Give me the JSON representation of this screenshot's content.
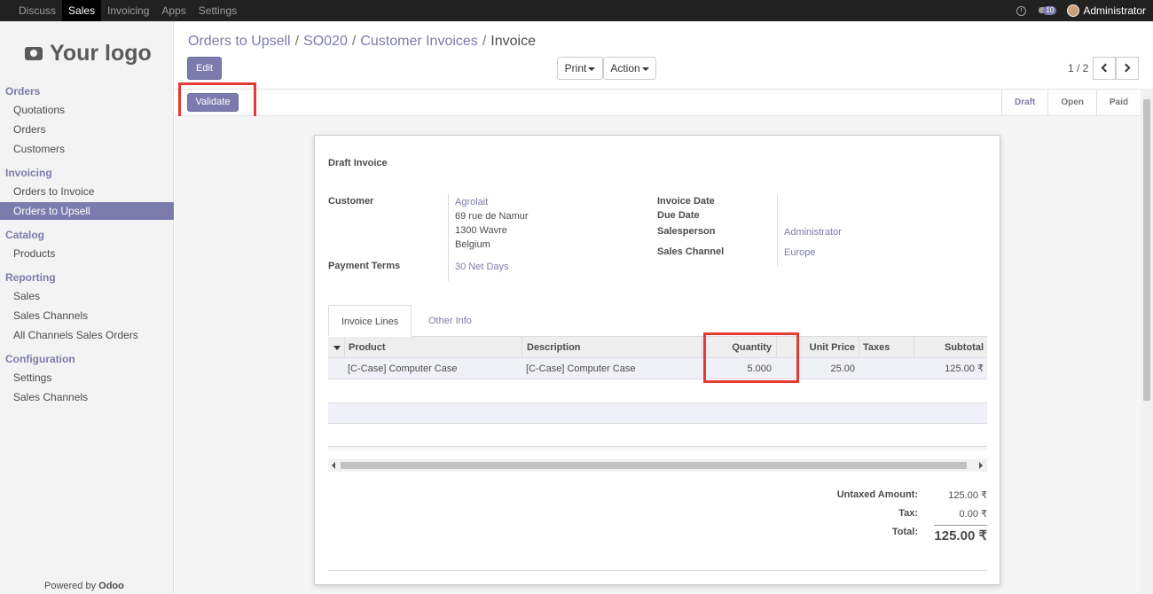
{
  "topbar": {
    "menu": [
      "Discuss",
      "Sales",
      "Invoicing",
      "Apps",
      "Settings"
    ],
    "active": "Sales",
    "chat_count": "10",
    "user": "Administrator"
  },
  "sidebar": {
    "logo_text": "Your logo",
    "sections": [
      {
        "title": "Orders",
        "items": [
          "Quotations",
          "Orders",
          "Customers"
        ]
      },
      {
        "title": "Invoicing",
        "items": [
          "Orders to Invoice",
          "Orders to Upsell"
        ]
      },
      {
        "title": "Catalog",
        "items": [
          "Products"
        ]
      },
      {
        "title": "Reporting",
        "items": [
          "Sales",
          "Sales Channels",
          "All Channels Sales Orders"
        ]
      },
      {
        "title": "Configuration",
        "items": [
          "Settings",
          "Sales Channels"
        ]
      }
    ],
    "active_item": "Orders to Upsell",
    "powered_by": "Powered by",
    "powered_brand": "Odoo"
  },
  "breadcrumb": [
    "Orders to Upsell",
    "SO020",
    "Customer Invoices",
    "Invoice"
  ],
  "toolbar": {
    "edit": "Edit",
    "print": "Print",
    "action": "Action",
    "pager": "1 / 2",
    "validate": "Validate"
  },
  "stages": [
    "Draft",
    "Open",
    "Paid"
  ],
  "active_stage": "Draft",
  "invoice": {
    "title": "Draft Invoice",
    "customer_label": "Customer",
    "customer_name": "Agrolait",
    "address": [
      "69 rue de Namur",
      "1300 Wavre",
      "Belgium"
    ],
    "payment_terms_label": "Payment Terms",
    "payment_terms": "30 Net Days",
    "invoice_date_label": "Invoice Date",
    "due_date_label": "Due Date",
    "salesperson_label": "Salesperson",
    "salesperson": "Administrator",
    "sales_channel_label": "Sales Channel",
    "sales_channel": "Europe"
  },
  "tabs": [
    "Invoice Lines",
    "Other Info"
  ],
  "table": {
    "headers": [
      "Product",
      "Description",
      "Quantity",
      "Unit Price",
      "Taxes",
      "Subtotal"
    ],
    "rows": [
      {
        "product": "[C-Case] Computer Case",
        "description": "[C-Case] Computer Case",
        "quantity": "5.000",
        "unit_price": "25.00",
        "taxes": "",
        "subtotal": "125.00 ₹"
      }
    ]
  },
  "totals": {
    "untaxed_label": "Untaxed Amount:",
    "untaxed": "125.00 ₹",
    "tax_label": "Tax:",
    "tax": "0.00 ₹",
    "total_label": "Total:",
    "total": "125.00 ₹"
  }
}
